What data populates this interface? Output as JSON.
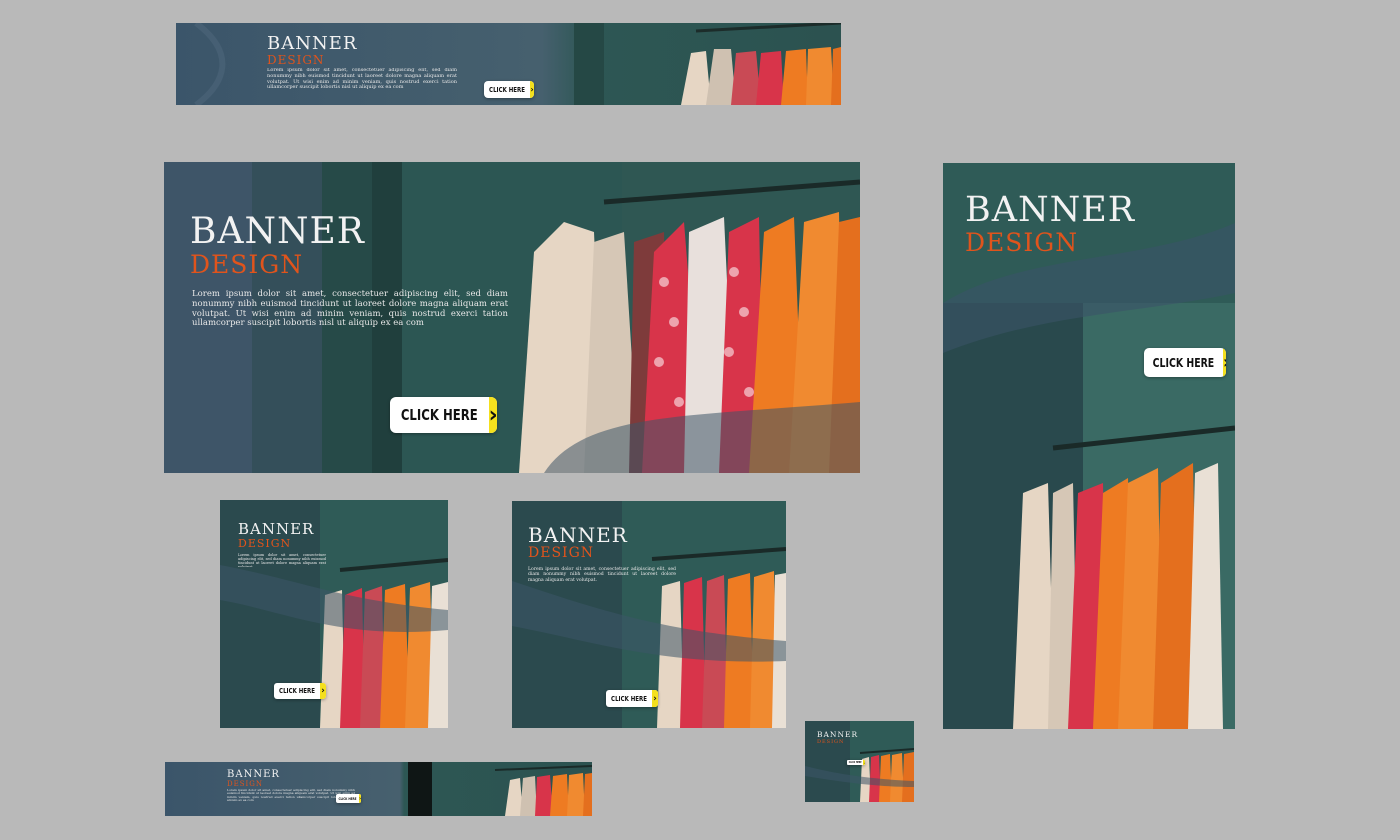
{
  "colors": {
    "canvas": "#b9b9b9",
    "panel_slate": "#3d5568",
    "panel_teal": "#2f5b57",
    "title": "#f2f2f2",
    "subtitle_orange": "#e0541c",
    "button_bg": "#ffffff",
    "button_arrow": "#f4e01e",
    "clothes_orange": "#ee7b22",
    "clothes_red": "#d8344a",
    "clothes_cream": "#e6d6c4"
  },
  "copy": {
    "title": "BANNER",
    "subtitle": "DESIGN",
    "cta": "CLICK HERE",
    "cta_icon": "chevron-right-icon",
    "body_long": "Lorem ipsum dolor sit amet, consectetuer adipiscing elit, sed diam nonummy nibh euismod tincidunt ut laoreet dolore magna aliquam erat volutpat. Ut wisi enim ad minim veniam, quis nostrud exerci tation ullamcorper suscipit lobortis nisl ut aliquip ex ea com",
    "body_short": "Lorem ipsum dolor sit amet, consectetuer adipiscing elit, sed diam nonummy nibh euismod tincidunt ut laoreet dolore magna aliquam erat volutpat."
  },
  "banners": [
    {
      "id": "leaderboard",
      "photo": "clothing-rack-photo"
    },
    {
      "id": "large-landscape",
      "photo": "clothing-rack-photo"
    },
    {
      "id": "skyscraper",
      "photo": "clothing-rack-photo"
    },
    {
      "id": "square",
      "photo": "clothing-rack-photo"
    },
    {
      "id": "medium-rectangle",
      "photo": "clothing-rack-photo"
    },
    {
      "id": "small-square",
      "photo": "clothing-rack-photo"
    },
    {
      "id": "bottom-strip",
      "photo": "clothing-rack-photo"
    }
  ]
}
